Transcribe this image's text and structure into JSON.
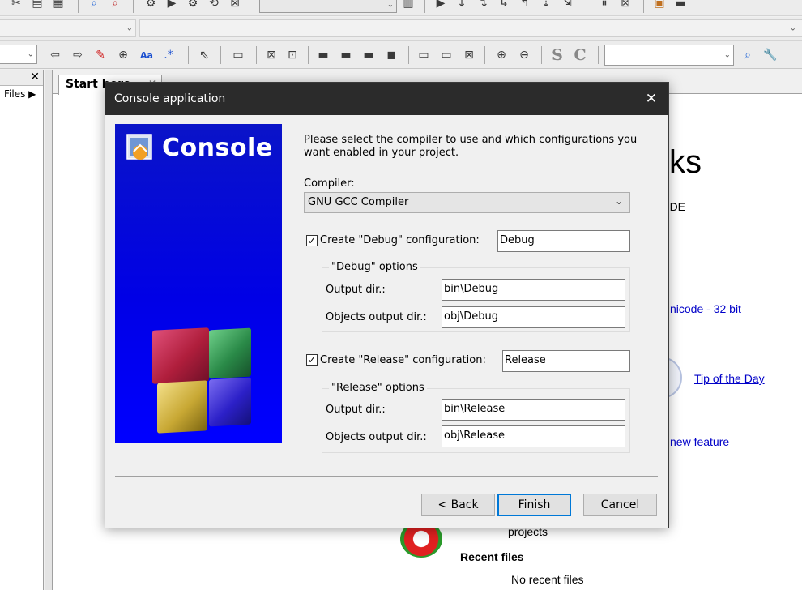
{
  "toolbar_top": {
    "icons": [
      "cut-icon",
      "copy-icon",
      "paste-icon",
      "find-icon",
      "replace-icon",
      "settings-icon",
      "run-icon",
      "build-run-icon",
      "rebuild-icon",
      "abort-icon"
    ],
    "debug_icons": [
      "debug-run-icon",
      "run-to-cursor-icon",
      "next-line-icon",
      "step-into-icon",
      "step-out-icon",
      "next-instruction-icon",
      "step-into-instruction-icon",
      "break-icon",
      "stop-debugger-icon"
    ]
  },
  "toolbar_edit": {
    "format_labels": [
      "S",
      "C"
    ]
  },
  "left_panel": {
    "close_glyph": "✕",
    "tab_label": "Files ▶"
  },
  "start_page": {
    "tab_label": "Start here",
    "tab_close": "✕",
    "heading_fragment": "ks",
    "subheading_fragment": "n IDE",
    "link_unicode": "nicode - 32 bit",
    "link_tip": "Tip of the Day",
    "link_feature": "new feature ",
    "projects_text": "projects",
    "recent_files_heading": "Recent files",
    "no_recent_files": "No recent files"
  },
  "dialog": {
    "title": "Console application",
    "close_glyph": "✕",
    "banner_title": "Console",
    "intro": "Please select the compiler to use and which configurations you want enabled in your project.",
    "compiler_label": "Compiler:",
    "compiler_value": "GNU GCC Compiler",
    "debug": {
      "checked": true,
      "check_glyph": "✓",
      "label": "Create \"Debug\" configuration:",
      "name": "Debug",
      "group_caption": "\"Debug\" options",
      "output_label": "Output dir.:",
      "output_value": "bin\\Debug",
      "objects_label": "Objects output dir.:",
      "objects_value": "obj\\Debug"
    },
    "release": {
      "checked": true,
      "check_glyph": "✓",
      "label": "Create \"Release\" configuration:",
      "name": "Release",
      "group_caption": "\"Release\" options",
      "output_label": "Output dir.:",
      "output_value": "bin\\Release",
      "objects_label": "Objects output dir.:",
      "objects_value": "obj\\Release"
    },
    "buttons": {
      "back": "< Back",
      "finish": "Finish",
      "cancel": "Cancel"
    }
  }
}
